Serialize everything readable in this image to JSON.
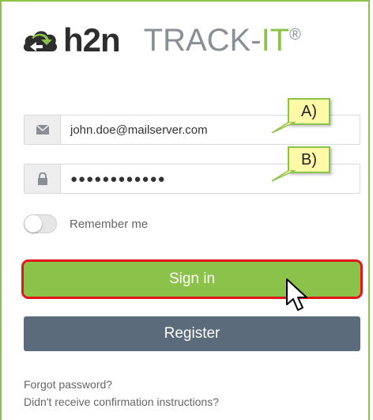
{
  "logo": {
    "brand": "h2n",
    "product_main": "TRACK-",
    "product_accent": "IT",
    "registered": "®"
  },
  "email": {
    "icon": "envelope-icon",
    "value": "john.doe@mailserver.com"
  },
  "password": {
    "icon": "lock-icon",
    "value": "●●●●●●●●●●●●"
  },
  "callouts": {
    "a": "A)",
    "b": "B)"
  },
  "remember": {
    "label": "Remember me",
    "checked": false
  },
  "buttons": {
    "signin": "Sign in",
    "register": "Register"
  },
  "links": {
    "forgot": "Forgot password?",
    "confirmation": "Didn't receive confirmation instructions?"
  },
  "colors": {
    "accent": "#8bc34a",
    "register": "#5b6b7b",
    "highlight": "#e0161b",
    "callout_bg": "#fff9a8"
  }
}
